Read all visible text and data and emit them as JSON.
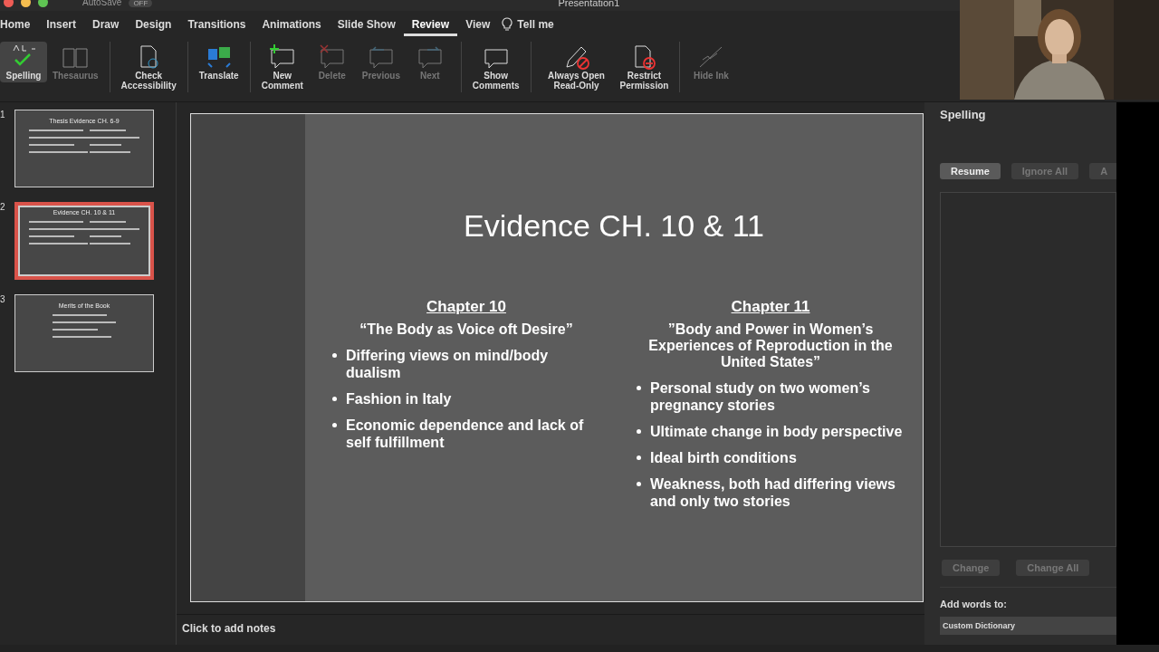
{
  "title_bar": {
    "autosave": "AutoSave",
    "autosave_state": "OFF",
    "document": "Presentation1"
  },
  "tabs": [
    {
      "label": "Home",
      "selected": false
    },
    {
      "label": "Insert",
      "selected": false
    },
    {
      "label": "Draw",
      "selected": false
    },
    {
      "label": "Design",
      "selected": false
    },
    {
      "label": "Transitions",
      "selected": false
    },
    {
      "label": "Animations",
      "selected": false
    },
    {
      "label": "Slide Show",
      "selected": false
    },
    {
      "label": "Review",
      "selected": true
    },
    {
      "label": "View",
      "selected": false
    }
  ],
  "tell_me": "Tell me",
  "ribbon": [
    {
      "kind": "spelling",
      "label": "Spelling",
      "disabled": false,
      "selected": true
    },
    {
      "kind": "thesaurus",
      "label": "Thesaurus",
      "disabled": true,
      "selected": false
    },
    {
      "kind": "accessibility",
      "label": "Check Accessibility",
      "disabled": false,
      "selected": false
    },
    {
      "kind": "translate",
      "label": "Translate",
      "disabled": false,
      "selected": false
    },
    {
      "kind": "new_comment",
      "label": "New Comment",
      "disabled": false,
      "selected": false
    },
    {
      "kind": "delete",
      "label": "Delete",
      "disabled": true,
      "selected": false
    },
    {
      "kind": "previous",
      "label": "Previous",
      "disabled": true,
      "selected": false
    },
    {
      "kind": "next",
      "label": "Next",
      "disabled": true,
      "selected": false
    },
    {
      "kind": "show_comments",
      "label": "Show Comments",
      "disabled": false,
      "selected": false
    },
    {
      "kind": "read_only",
      "label": "Always Open Read-Only",
      "disabled": false,
      "selected": false
    },
    {
      "kind": "restrict",
      "label": "Restrict Permission",
      "disabled": false,
      "selected": false
    },
    {
      "kind": "hide_ink",
      "label": "Hide Ink",
      "disabled": true,
      "selected": false
    }
  ],
  "thumbnails": [
    {
      "number": "1",
      "title": "Thesis Evidence CH. 6-9",
      "selected": false
    },
    {
      "number": "2",
      "title": "Evidence CH. 10 & 11",
      "selected": true
    },
    {
      "number": "3",
      "title": "Merits of the Book",
      "selected": false
    }
  ],
  "slide": {
    "title": "Evidence CH. 10 & 11",
    "columns": [
      {
        "heading": "Chapter 10",
        "subtitle": "“The Body as Voice oft Desire”",
        "bullets": [
          "Differing views on mind/body dualism",
          "Fashion in Italy",
          "Economic dependence and lack of self fulfillment"
        ]
      },
      {
        "heading": "Chapter 11",
        "subtitle": "”Body and Power in Women’s Experiences of Reproduction in the United States”",
        "bullets": [
          "Personal study on two women’s pregnancy stories",
          "Ultimate change in body perspective",
          "Ideal birth conditions",
          "Weakness, both had differing views and only two stories"
        ]
      }
    ]
  },
  "notes": {
    "placeholder": "Click to add notes"
  },
  "spelling_pane": {
    "title": "Spelling",
    "buttons": [
      {
        "label": "Resume",
        "disabled": false
      },
      {
        "label": "Ignore All",
        "disabled": true
      },
      {
        "label": "A",
        "disabled": true
      }
    ],
    "change_buttons": [
      {
        "label": "Change",
        "disabled": true
      },
      {
        "label": "Change All",
        "disabled": true
      }
    ],
    "add_words_label": "Add words to:",
    "dictionary": "Custom Dictionary"
  }
}
